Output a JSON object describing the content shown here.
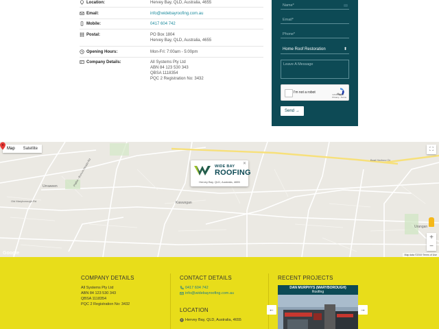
{
  "contact": {
    "rows": [
      {
        "label": "Location:",
        "lines": [
          "Hervey Bay, QLD, Australia, 4655"
        ],
        "link": false
      },
      {
        "label": "Email:",
        "lines": [
          "info@widebayroofing.com.au"
        ],
        "link": true
      },
      {
        "label": "Mobile:",
        "lines": [
          "0417 604 742"
        ],
        "link": true
      },
      {
        "label": "Postal:",
        "lines": [
          "PO Box 1804",
          "Hervey Bay, QLD, Australia, 4655"
        ],
        "link": false
      },
      {
        "label": "Opening Hours:",
        "lines": [
          "Mon-Fri: 7:00am - 5:00pm"
        ],
        "link": false
      },
      {
        "label": "Company Details:",
        "lines": [
          "All Systems Pty Ltd",
          "ABN 84 123 530 343",
          "QBSA 1118354",
          "PQC 2 Registration No: 3432"
        ],
        "link": false
      }
    ]
  },
  "form": {
    "name_placeholder": "Name*",
    "email_placeholder": "Email*",
    "phone_placeholder": "Phone*",
    "service_selected": "Home Roof Restoration",
    "message_placeholder": "Leave A Message",
    "captcha_label": "I'm not a robot",
    "captcha_brand": "reCAPTCHA",
    "captcha_small": "Privacy - Terms",
    "send_label": "Send →"
  },
  "map": {
    "tab_map": "Map",
    "tab_satellite": "Satellite",
    "popup_brand_top": "WIDE BAY",
    "popup_brand_main": "ROOFING",
    "popup_address": "Hervey Bay, QLD, Australia, 4655",
    "labels": {
      "urraween": "Urraween",
      "kawungan": "Kawungan",
      "urangan": "Urangan",
      "boat_harbour": "Boat Harbour Dr",
      "old_maryborough": "Old Maryborough Rd",
      "pialba_burrum": "Pialba - Burrum Heads Rd"
    },
    "footer": "Map data ©2019  Terms of Use",
    "google": "Google",
    "zoom_in": "+",
    "zoom_out": "−"
  },
  "footer": {
    "company_title": "COMPANY DETAILS",
    "company_lines": [
      "All Systems Pty Ltd",
      "ABN 84 123 530 343",
      "QBSA 1118354",
      "PQC 2 Registration No: 3432"
    ],
    "contact_title": "CONTACT DETAILS",
    "phone": "0417 604 742",
    "email": "info@widebayroofing.com.au",
    "location_title": "LOCATION",
    "location": "Hervey Bay, QLD, Australia, 4655",
    "projects_title": "RECENT PROJECTS",
    "project_name": "DAN MURPHYS (MARYBOROUGH)",
    "project_type": "Roofing",
    "prev": "←",
    "next": "→"
  },
  "colors": {
    "teal": "#0d4a55",
    "link": "#1a8a9c",
    "footer_yellow": "#e8dd1a"
  }
}
